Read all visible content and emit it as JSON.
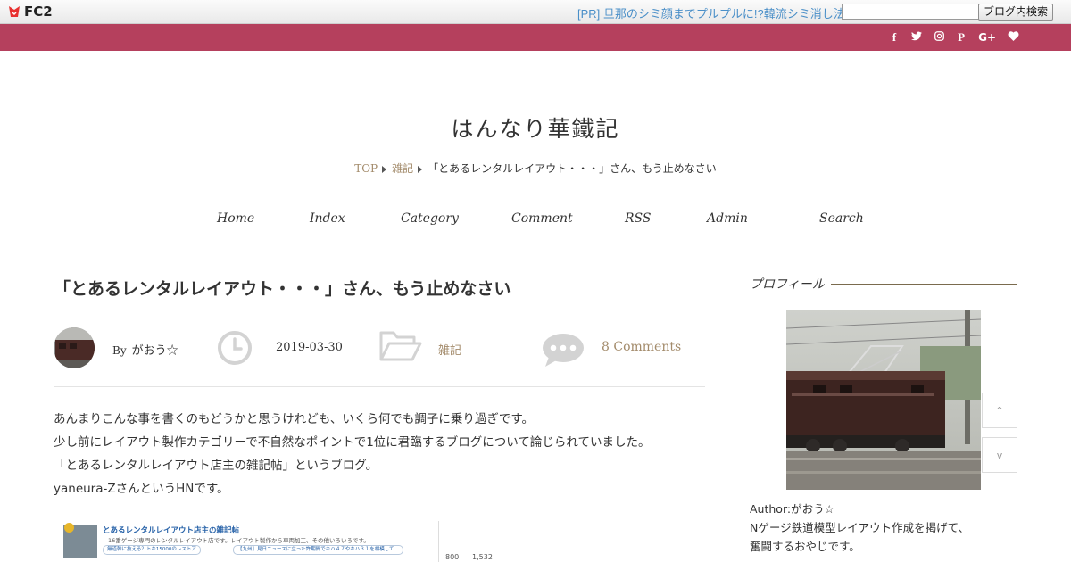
{
  "fc2": {
    "logo_text": "FC2",
    "pr_text": "[PR] 旦那のシミ顔までプルプルに!?韓流シミ消し法が",
    "search_value": "",
    "search_button": "ブログ内検索"
  },
  "social": {
    "icons": [
      "f",
      "t",
      "ig",
      "p",
      "g+",
      "heart"
    ]
  },
  "blog": {
    "title": "はんなり華鐵記"
  },
  "breadcrumb": {
    "top": "TOP",
    "category": "雑記",
    "current": "「とあるレンタルレイアウト・・・」さん、もう止めなさい"
  },
  "nav": {
    "home": "Home",
    "index": "Index",
    "category": "Category",
    "comment": "Comment",
    "rss": "RSS",
    "admin": "Admin",
    "search": "Search"
  },
  "post": {
    "title": "「とあるレンタルレイアウト・・・」さん、もう止めなさい",
    "by_label": "By",
    "author": "がおう☆",
    "date": "2019-03-30",
    "category": "雑記",
    "comments": "8 Comments",
    "body": [
      "あんまりこんな事を書くのもどうかと思うけれども、いくら何でも調子に乗り過ぎです。",
      "少し前にレイアウト製作カテゴリーで不自然なポイントで1位に君臨するブログについて論じられていました。",
      "「とあるレンタルレイアウト店主の雑記帖」というブログ。",
      "yaneura-ZさんというHNです。"
    ],
    "screenshot": {
      "title": "とあるレンタルレイアウト店主の雑記帖",
      "desc": "16番ゲージ専門のレンタルレイアウト店です。レイアウト製作から車両加工、その他いろいろです。",
      "tags": [
        "無道幹に抜える？トキ15000のレストア",
        "【九州】見日ニュースに立った許期間でキハ４７やキハ３１を相模して..."
      ],
      "stat_a": "800",
      "stat_b": "1,532"
    }
  },
  "sidebar": {
    "profile_title": "プロフィール",
    "author_line": "Author:がおう☆",
    "desc_lines": [
      "Nゲージ鉄道模型レイアウト作成を掲げて、",
      "奮闘するおやじです。"
    ]
  },
  "scroll": {
    "up_label": "^",
    "down_label": "v"
  },
  "colors": {
    "band": "#b5405d",
    "accent": "#a38b6b",
    "link": "#4a8fc8"
  }
}
